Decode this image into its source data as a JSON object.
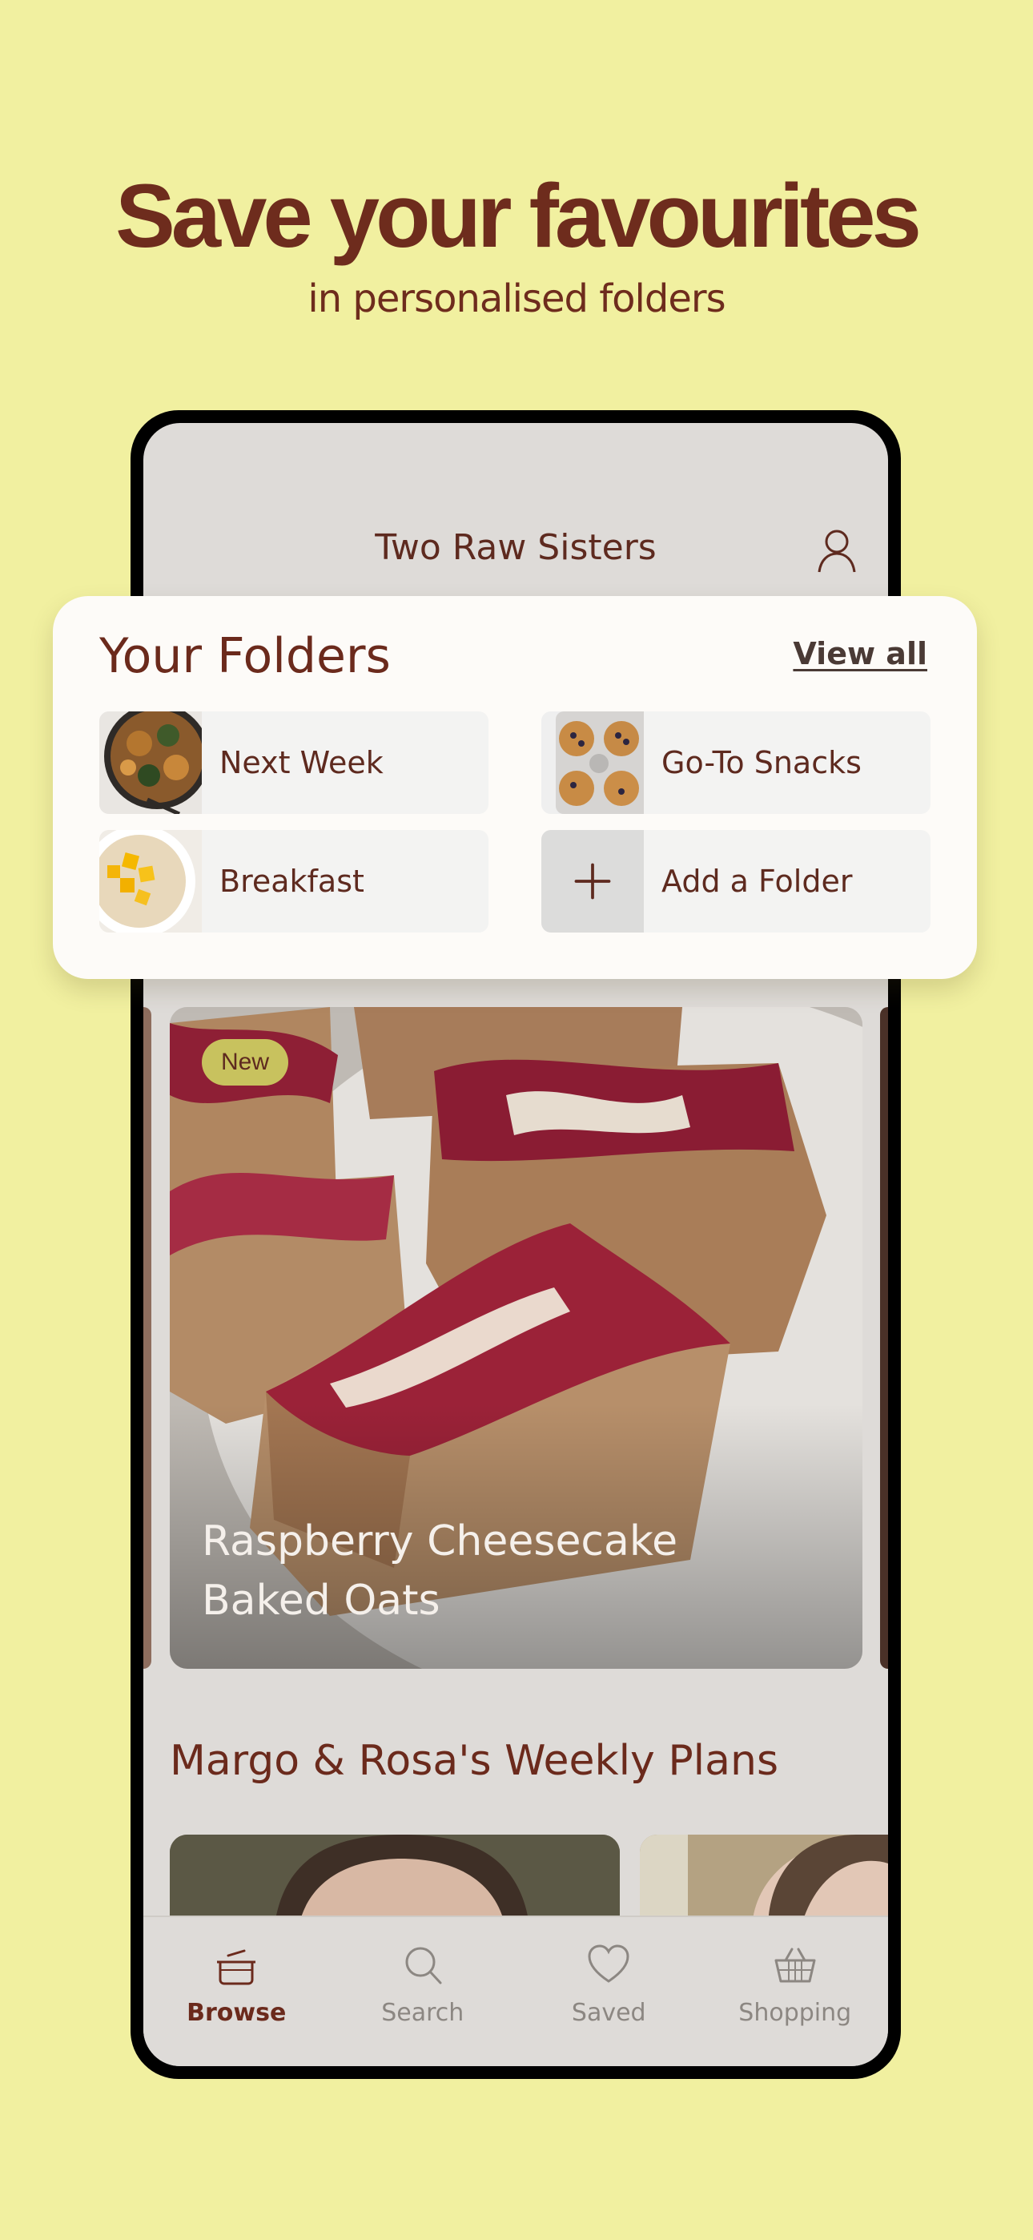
{
  "headline": "Save your favourites",
  "subheadline": "in personalised folders",
  "app": {
    "title": "Two Raw Sisters",
    "profile_icon": "user-icon"
  },
  "folders": {
    "title": "Your Folders",
    "view_all": "View all",
    "items": [
      {
        "label": "Next Week",
        "thumb": "baked-dish-thumbnail"
      },
      {
        "label": "Go-To Snacks",
        "thumb": "muffins-thumbnail"
      },
      {
        "label": "Breakfast",
        "thumb": "porridge-mango-thumbnail"
      },
      {
        "label": "Add a Folder",
        "thumb": "plus-icon"
      }
    ]
  },
  "featured": {
    "badge": "New",
    "title": "Raspberry Cheesecake Baked Oats"
  },
  "weekly_section": {
    "title": "Margo & Rosa's Weekly Plans"
  },
  "tabs": [
    {
      "label": "Browse",
      "icon": "pot-icon",
      "active": true
    },
    {
      "label": "Search",
      "icon": "search-icon",
      "active": false
    },
    {
      "label": "Saved",
      "icon": "heart-icon",
      "active": false
    },
    {
      "label": "Shopping",
      "icon": "basket-icon",
      "active": false
    }
  ],
  "colors": {
    "background": "#f1f0a0",
    "brand_brown": "#6b2a1c",
    "badge": "#c8c25e",
    "screen": "#dedbd8"
  }
}
